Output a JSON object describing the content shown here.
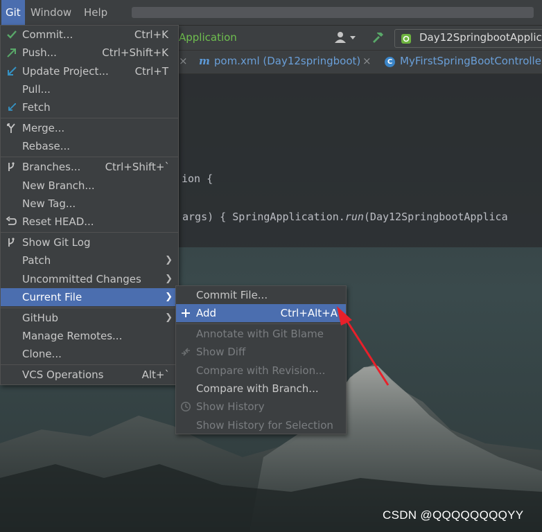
{
  "menubar": {
    "items": [
      "Git",
      "Window",
      "Help"
    ]
  },
  "toolbar": {
    "app_label": "Application",
    "run_config": "Day12SpringbootApplic"
  },
  "tabs": [
    {
      "label": "pom.xml (Day12springboot)",
      "icon": "maven-icon"
    },
    {
      "label": "MyFirstSpringBootControlle",
      "icon": "class-icon"
    }
  ],
  "editor": {
    "line1": "ion {",
    "line2_params": "args) { ",
    "line2_class": "SpringApplication.",
    "line2_method": "run",
    "line2_rest": "(Day12SpringbootApplica"
  },
  "git_menu": {
    "items": [
      {
        "label": "Commit...",
        "shortcut": "Ctrl+K",
        "icon": "check-icon"
      },
      {
        "label": "Push...",
        "shortcut": "Ctrl+Shift+K",
        "icon": "push-arrow-icon"
      },
      {
        "label": "Update Project...",
        "shortcut": "Ctrl+T",
        "icon": "update-arrow-icon"
      },
      {
        "label": "Pull...",
        "shortcut": ""
      },
      {
        "label": "Fetch",
        "shortcut": "",
        "icon": "fetch-arrow-icon"
      },
      {
        "label": "Merge...",
        "shortcut": "",
        "icon": "merge-icon"
      },
      {
        "label": "Rebase...",
        "shortcut": ""
      },
      {
        "label": "Branches...",
        "shortcut": "Ctrl+Shift+`",
        "icon": "branch-icon"
      },
      {
        "label": "New Branch...",
        "shortcut": ""
      },
      {
        "label": "New Tag...",
        "shortcut": ""
      },
      {
        "label": "Reset HEAD...",
        "shortcut": "",
        "icon": "reset-icon"
      },
      {
        "label": "Show Git Log",
        "shortcut": "",
        "icon": "branch-icon"
      },
      {
        "label": "Patch",
        "shortcut": "",
        "submenu": true
      },
      {
        "label": "Uncommitted Changes",
        "shortcut": "",
        "submenu": true
      },
      {
        "label": "Current File",
        "shortcut": "",
        "submenu": true,
        "selected": true
      },
      {
        "label": "GitHub",
        "shortcut": "",
        "submenu": true
      },
      {
        "label": "Manage Remotes...",
        "shortcut": ""
      },
      {
        "label": "Clone...",
        "shortcut": ""
      },
      {
        "label": "VCS Operations",
        "shortcut": "Alt+`"
      }
    ]
  },
  "current_file_menu": {
    "items": [
      {
        "label": "Commit File...",
        "shortcut": "",
        "enabled": true
      },
      {
        "label": "Add",
        "shortcut": "Ctrl+Alt+A",
        "enabled": true,
        "selected": true,
        "icon": "plus-icon"
      },
      {
        "label": "Annotate with Git Blame",
        "shortcut": "",
        "enabled": false
      },
      {
        "label": "Show Diff",
        "shortcut": "",
        "enabled": false,
        "icon": "diff-icon"
      },
      {
        "label": "Compare with Revision...",
        "shortcut": "",
        "enabled": false
      },
      {
        "label": "Compare with Branch...",
        "shortcut": "",
        "enabled": true
      },
      {
        "label": "Show History",
        "shortcut": "",
        "enabled": false,
        "icon": "history-icon"
      },
      {
        "label": "Show History for Selection",
        "shortcut": "",
        "enabled": false
      }
    ]
  },
  "watermark": "CSDN @QQQQQQQQYY",
  "colors": {
    "selection": "#4b6eaf",
    "menu_bg": "#3c3f41",
    "annotation_arrow": "#e8202a",
    "green_label": "#6fbf4f"
  }
}
